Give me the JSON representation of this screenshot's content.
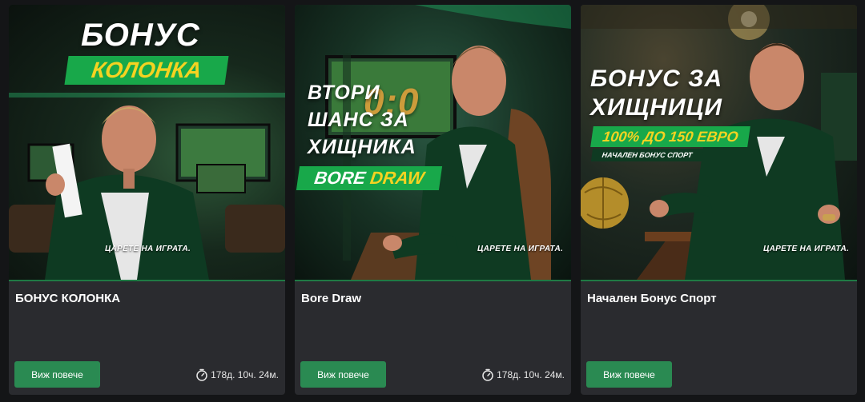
{
  "colors": {
    "page_bg": "#141517",
    "card_bg": "#2a2b2f",
    "accent_green": "#18a84a",
    "button_green": "#2a8a52",
    "highlight_yellow": "#f5d321"
  },
  "cards": [
    {
      "banner": {
        "line1": "БОНУС",
        "badge": "КОЛОНКА",
        "tagline": "ЦАРЕТЕ НА ИГРАТА."
      },
      "title": "БОНУС КОЛОНКА",
      "button_label": "Виж повече",
      "timer": "178д. 10ч. 24м.",
      "timer_icon": "stopwatch-icon"
    },
    {
      "banner": {
        "line1": "ВТОРИ",
        "line2": "ШАНС ЗА",
        "line3": "ХИЩНИКА",
        "badge_part1": "BORE",
        "badge_part2": "DRAW",
        "score": "0:0",
        "tagline": "ЦАРЕТЕ НА ИГРАТА."
      },
      "title": "Bore Draw",
      "button_label": "Виж повече",
      "timer": "178д. 10ч. 24м.",
      "timer_icon": "stopwatch-icon"
    },
    {
      "banner": {
        "line1": "БОНУС ЗА",
        "line2": "ХИЩНИЦИ",
        "badge": "100% ДО 150 ЕВРО",
        "sub_badge": "НАЧАЛЕН БОНУС СПОРТ",
        "tagline": "ЦАРЕТЕ НА ИГРАТА."
      },
      "title": "Начален Бонус Спорт",
      "button_label": "Виж повече"
    }
  ]
}
